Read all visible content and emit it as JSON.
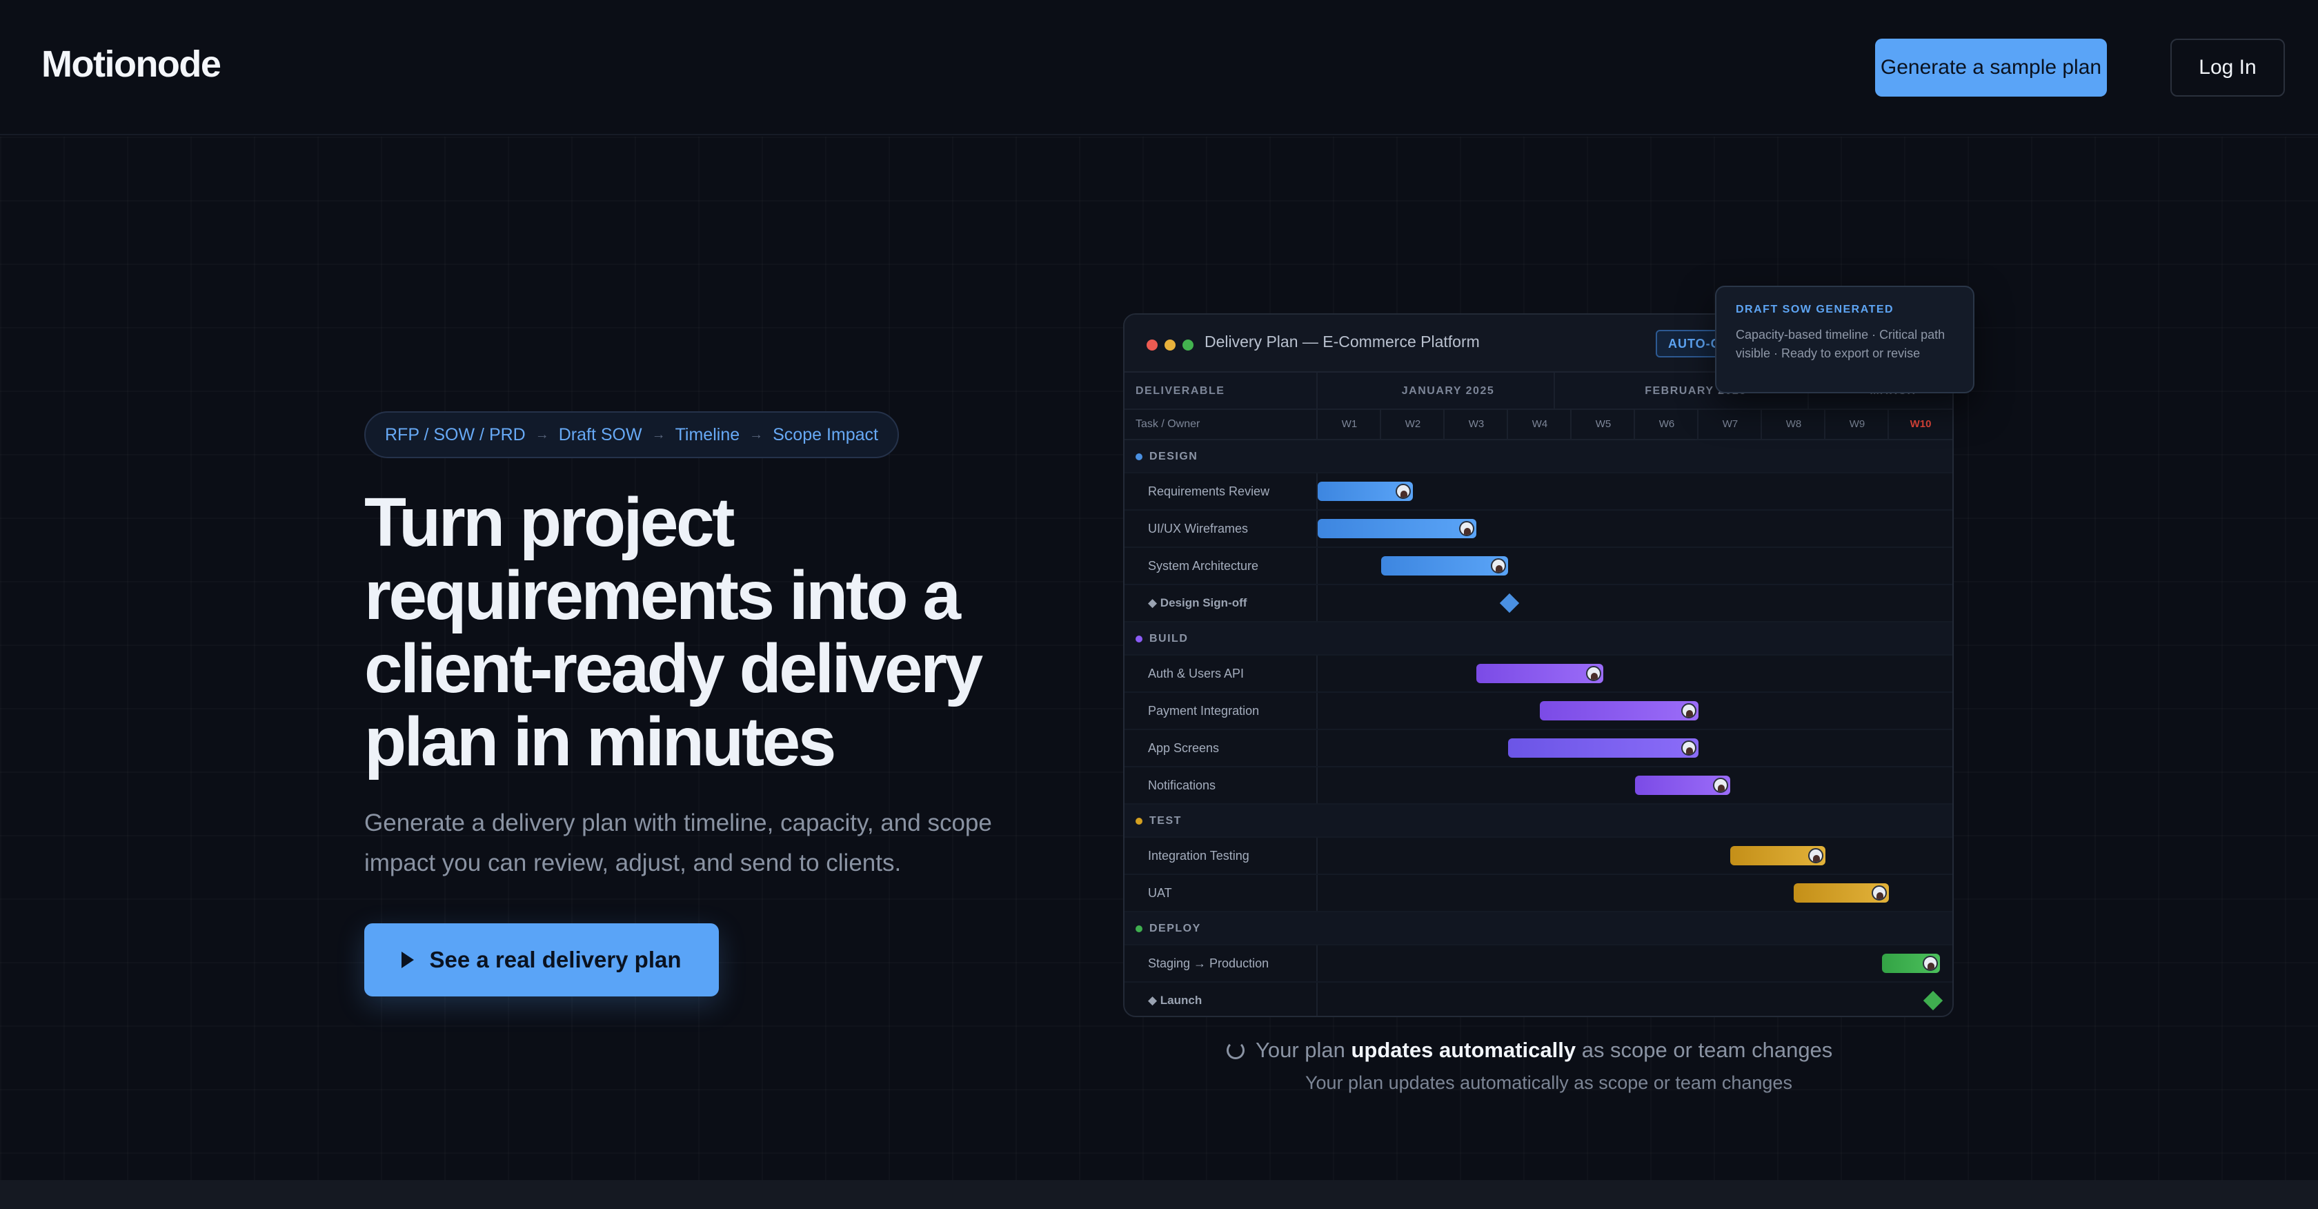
{
  "header": {
    "logo": "Motionode",
    "sample_button": "Generate a sample plan",
    "login_button": "Log In"
  },
  "hero": {
    "pill": [
      "RFP / SOW / PRD",
      "Draft SOW",
      "Timeline",
      "Scope Impact"
    ],
    "pill_arrow": "→",
    "headline": "Turn project requirements into a client-ready delivery plan in minutes",
    "subtext": "Generate a delivery plan with timeline, capacity, and scope impact you can review, adjust, and send to clients.",
    "cta": "See a real delivery plan"
  },
  "gantt": {
    "window_title": "Delivery Plan — E-Commerce Platform",
    "badge": "AUTO-GENERATED",
    "deliverable_header": "DELIVERABLE",
    "task_owner_header": "Task / Owner",
    "months": [
      "JANUARY 2025",
      "FEBRUARY 2025",
      "MARCH"
    ],
    "weeks": [
      "W1",
      "W2",
      "W3",
      "W4",
      "W5",
      "W6",
      "W7",
      "W8",
      "W9",
      "W10"
    ],
    "highlight_week_color": "#e0453a",
    "sections": {
      "design": "DESIGN",
      "build": "BUILD",
      "test": "TEST",
      "deploy": "DEPLOY"
    },
    "tasks": {
      "req": "Requirements Review",
      "ux": "UI/UX Wireframes",
      "arch": "System Architecture",
      "signoff": "◆ Design Sign-off",
      "auth": "Auth & Users API",
      "pay": "Payment Integration",
      "screens": "App Screens",
      "notif": "Notifications",
      "integ": "Integration Testing",
      "uat": "UAT",
      "staging": "Staging → Production",
      "launch": "◆ Launch"
    },
    "colors": {
      "design": "#4a90e2",
      "build": "#8b5cf6",
      "test": "#d4a020",
      "deploy": "#3fae4f"
    }
  },
  "toast": {
    "title": "DRAFT SOW GENERATED",
    "body": "Capacity-based timeline · Critical path visible · Ready to export or revise"
  },
  "caption": {
    "prefix": "Your plan",
    "bold": "updates automatically",
    "suffix": "as scope or team changes",
    "sub": "Your plan updates automatically as scope or team changes"
  }
}
